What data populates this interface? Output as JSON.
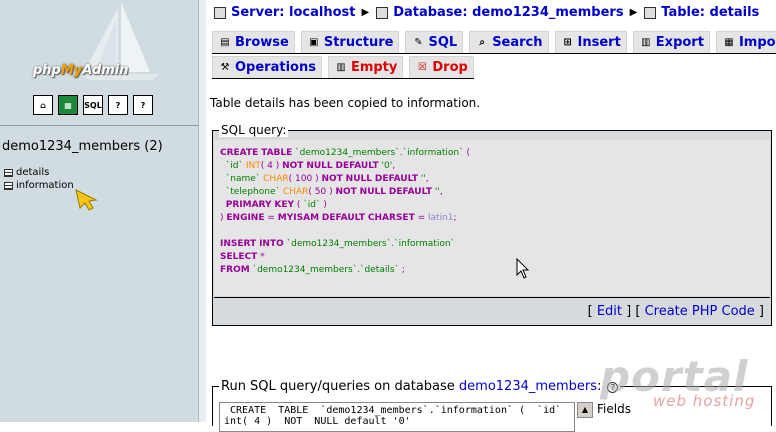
{
  "nav": {
    "logo": {
      "php": "php",
      "my": "My",
      "admin": "Admin"
    },
    "icons": [
      "home-icon",
      "query-window-icon",
      "sql-icon",
      "help-icon",
      "docs-icon"
    ],
    "db_title": "demo1234_members (2)",
    "tables": [
      "details",
      "information"
    ]
  },
  "breadcrumb": {
    "server": "Server: localhost",
    "database": "Database: demo1234_members",
    "table": "Table: details"
  },
  "tabs_row1": [
    "Browse",
    "Structure",
    "SQL",
    "Search",
    "Insert",
    "Export",
    "Import"
  ],
  "tabs_row2": [
    "Operations",
    "Empty",
    "Drop"
  ],
  "notice": "Table details has been copied to information.",
  "sql_box": {
    "legend": "SQL query:",
    "lines": [
      "CREATE TABLE `demo1234_members`.`information` (",
      "  `id` INT( 4 ) NOT NULL DEFAULT '0',",
      "  `name` CHAR( 100 ) NOT NULL DEFAULT '',",
      "  `telephone` CHAR( 50 ) NOT NULL DEFAULT '',",
      "  PRIMARY KEY ( `id` )",
      ") ENGINE = MYISAM DEFAULT CHARSET = latin1;",
      "",
      "INSERT INTO `demo1234_members`.`information`",
      "SELECT *",
      "FROM `demo1234_members`.`details` ;"
    ],
    "edit_link": "Edit",
    "php_link": "Create PHP Code"
  },
  "run_sql": {
    "legend_prefix": "Run SQL query/queries on database ",
    "db_link": "demo1234_members",
    "legend_suffix": ":",
    "textarea_line1": " CREATE  TABLE  `demo1234_members`.`information` (  `id`",
    "textarea_line2": "int( 4 )  NOT  NULL default '0'",
    "fields_label": "Fields"
  },
  "watermark": {
    "brand": "portal",
    "sub": "web hosting"
  },
  "colors": {
    "link": "#0000cc",
    "danger": "#e00000",
    "nav_bg": "#d0dce0",
    "sql_bg": "#e5e5e5"
  }
}
